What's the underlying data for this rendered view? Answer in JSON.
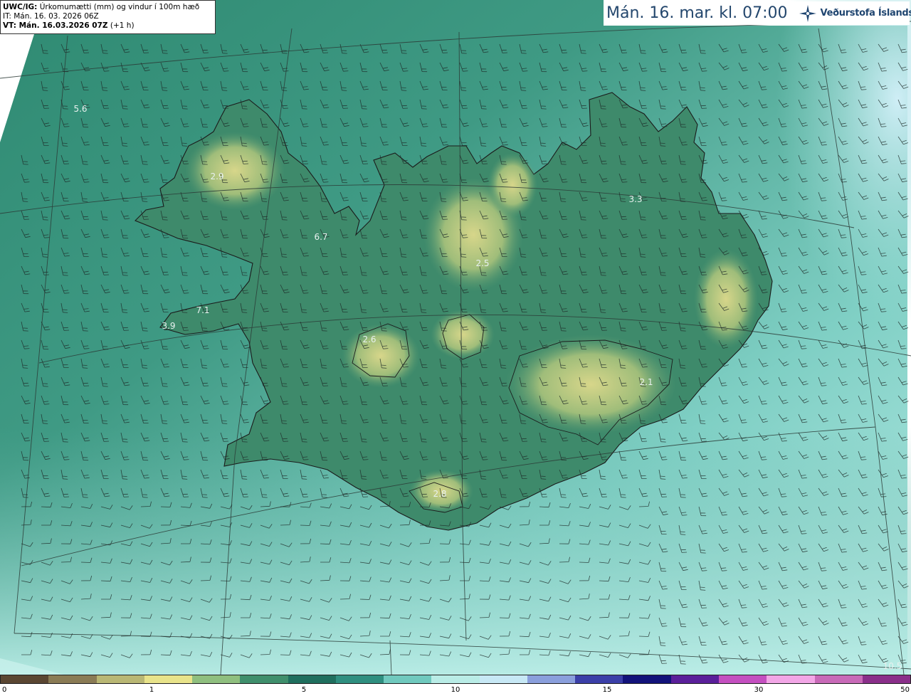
{
  "header": {
    "product_code": "UWC/IG:",
    "product_desc": "Úrkomumætti (mm) og vindur í 100m hæð",
    "init_time": "IT: Mán. 16. 03. 2026 06Z",
    "valid_label": "VT: Mán. 16.03.2026 07Z",
    "valid_offset": "(+1 h)"
  },
  "title": {
    "time_text": "Mán. 16. mar. kl. 07:00",
    "logo_text": "Veðurstofa Íslands",
    "logo_icon": "vedurstofa-star-icon"
  },
  "colorbar": {
    "ticks": [
      "0",
      "1",
      "5",
      "10",
      "15",
      "30",
      "50"
    ],
    "colors": [
      "#5a4632",
      "#8a7b55",
      "#b9b774",
      "#e8e38a",
      "#8fbf7f",
      "#3f8f6c",
      "#1f6f5e",
      "#2f8f80",
      "#70c9be",
      "#b9ece6",
      "#c7e8f5",
      "#8a9fdc",
      "#3b3fa8",
      "#12127a",
      "#5a1f9a",
      "#c44fc0",
      "#f2a6e6",
      "#c86ab8",
      "#8a2f8a"
    ]
  },
  "map": {
    "labels": [
      {
        "id": "v1",
        "text": "5.6"
      },
      {
        "id": "v2",
        "text": "2.9"
      },
      {
        "id": "v3",
        "text": "6.7"
      },
      {
        "id": "v4",
        "text": "7.1"
      },
      {
        "id": "v5",
        "text": "3.9"
      },
      {
        "id": "v6",
        "text": "2.6"
      },
      {
        "id": "v7",
        "text": "2.5"
      },
      {
        "id": "v8",
        "text": "3.3"
      },
      {
        "id": "v9",
        "text": "2.1"
      },
      {
        "id": "v10",
        "text": "2.8"
      },
      {
        "id": "v11",
        "text": "10.5"
      }
    ]
  }
}
